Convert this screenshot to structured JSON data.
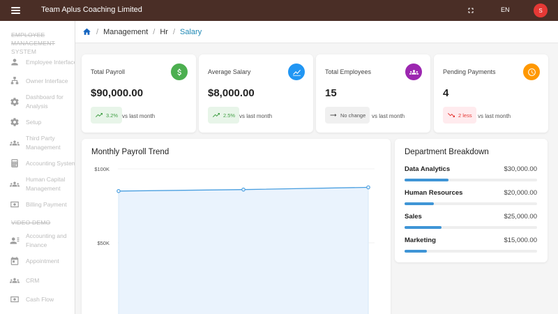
{
  "header": {
    "app_title": "Team Aplus Coaching Limited",
    "language": "EN",
    "avatar_initial": "S"
  },
  "sidebar": {
    "section1_line1": "EMPLOYEE MANAGEMENT",
    "section1_line2": "SYSTEM",
    "items1": [
      {
        "label": "Employee Interface",
        "icon": "person-icon"
      },
      {
        "label": "Owner Interface",
        "icon": "org-chart-icon"
      },
      {
        "label_line1": "Dashboard for",
        "label_line2": "Analysis",
        "icon": "gear-icon"
      },
      {
        "label": "Setup",
        "icon": "gear-icon"
      },
      {
        "label_line1": "Third Party",
        "label_line2": "Management",
        "icon": "groups-icon"
      },
      {
        "label": "Accounting System",
        "icon": "calculator-icon"
      },
      {
        "label_line1": "Human Capital",
        "label_line2": "Management",
        "icon": "groups-icon"
      },
      {
        "label": "Billing Payment",
        "icon": "money-icon"
      }
    ],
    "section2": "VIDEO DEMO",
    "items2": [
      {
        "label_line1": "Accounting and",
        "label_line2": "Finance",
        "icon": "person-card-icon"
      },
      {
        "label": "Appointment",
        "icon": "calendar-icon"
      },
      {
        "label": "CRM",
        "icon": "groups-icon"
      },
      {
        "label": "Cash Flow",
        "icon": "money-icon"
      }
    ]
  },
  "breadcrumb": [
    "Management",
    "Hr",
    "Salary"
  ],
  "stats": [
    {
      "label": "Total Payroll",
      "value": "$90,000.00",
      "change": "3.2%",
      "trend": "up",
      "note": "vs last month",
      "icon": "dollar-icon",
      "color": "#4caf50"
    },
    {
      "label": "Average Salary",
      "value": "$8,000.00",
      "change": "2.5%",
      "trend": "up",
      "note": "vs last month",
      "icon": "line-chart-icon",
      "color": "#2196f3"
    },
    {
      "label": "Total Employees",
      "value": "15",
      "change": "No change",
      "trend": "flat",
      "note": "vs last month",
      "icon": "groups-icon",
      "color": "#9c27b0"
    },
    {
      "label": "Pending Payments",
      "value": "4",
      "change": "2 less",
      "trend": "down",
      "note": "vs last month",
      "icon": "clock-icon",
      "color": "#ff9800"
    }
  ],
  "trend": {
    "title": "Monthly Payroll Trend"
  },
  "chart_data": {
    "type": "area",
    "title": "Monthly Payroll Trend",
    "xlabel": "",
    "ylabel": "",
    "y_ticks": [
      "$100K",
      "$50K"
    ],
    "ylim": [
      0,
      100000
    ],
    "x": [
      1,
      2,
      3
    ],
    "values": [
      85000,
      86000,
      87500
    ],
    "line_color": "#4a9fe0",
    "fill_color": "#eaf3fd",
    "grid": true
  },
  "department": {
    "title": "Department Breakdown",
    "items": [
      {
        "name": "Data Analytics",
        "amount": "$30,000.00",
        "share": 0.33
      },
      {
        "name": "Human Resources",
        "amount": "$20,000.00",
        "share": 0.22
      },
      {
        "name": "Sales",
        "amount": "$25,000.00",
        "share": 0.28
      },
      {
        "name": "Marketing",
        "amount": "$15,000.00",
        "share": 0.17
      }
    ]
  }
}
